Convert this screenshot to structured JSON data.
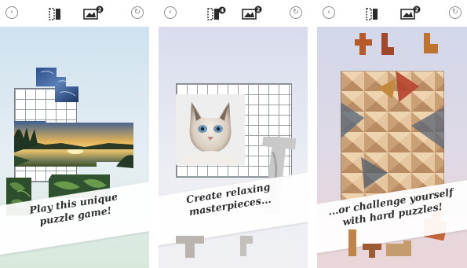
{
  "toolbar": {
    "back_glyph": "‹",
    "refresh_glyph": "↻",
    "hint_icon": "hint-icon",
    "image_icon": "image-icon",
    "back_icon": "back-icon",
    "refresh_icon": "refresh-icon"
  },
  "panels": [
    {
      "hint_count": "",
      "image_count": "2",
      "caption_line1": "Play this unique",
      "caption_line2": "puzzle game!"
    },
    {
      "hint_count": "4",
      "image_count": "2",
      "caption_line1": "Create relaxing",
      "caption_line2": "masterpieces..."
    },
    {
      "hint_count": "",
      "image_count": "2",
      "caption_line1": "...or challenge yourself",
      "caption_line2": "with hard puzzles!"
    }
  ],
  "colors": {
    "icon_gray": "#8c8c8c",
    "icon_dark": "#2b2b2b",
    "badge": "#1f1f1f",
    "caption_text": "#2d2d2d"
  }
}
